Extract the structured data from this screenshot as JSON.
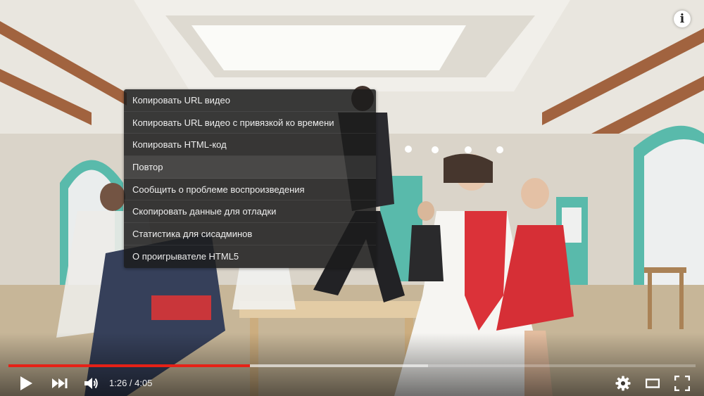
{
  "player": {
    "info_label": "i",
    "context_menu": {
      "items": [
        {
          "label": "Копировать URL видео"
        },
        {
          "label": "Копировать URL видео с привязкой ко времени"
        },
        {
          "label": "Копировать HTML-код"
        },
        {
          "label": "Повтор"
        },
        {
          "label": "Сообщить о проблеме воспроизведения"
        },
        {
          "label": "Скопировать данные для отладки"
        },
        {
          "label": "Статистика для сисадминов"
        },
        {
          "label": "О проигрывателе HTML5"
        }
      ],
      "highlighted_index": 3
    },
    "controls": {
      "current_time": "1:26",
      "duration": "4:05",
      "time_separator": " / ",
      "played_fraction": 0.351,
      "buffered_fraction": 0.611,
      "icons": {
        "play": "play-icon",
        "next": "next-icon",
        "volume": "volume-icon",
        "settings": "gear-icon",
        "theater": "theater-mode-icon",
        "fullscreen": "fullscreen-icon"
      }
    },
    "colors": {
      "progress_played": "#e62117",
      "menu_background": "#1c1c1c",
      "menu_text": "#eeeeee"
    }
  }
}
